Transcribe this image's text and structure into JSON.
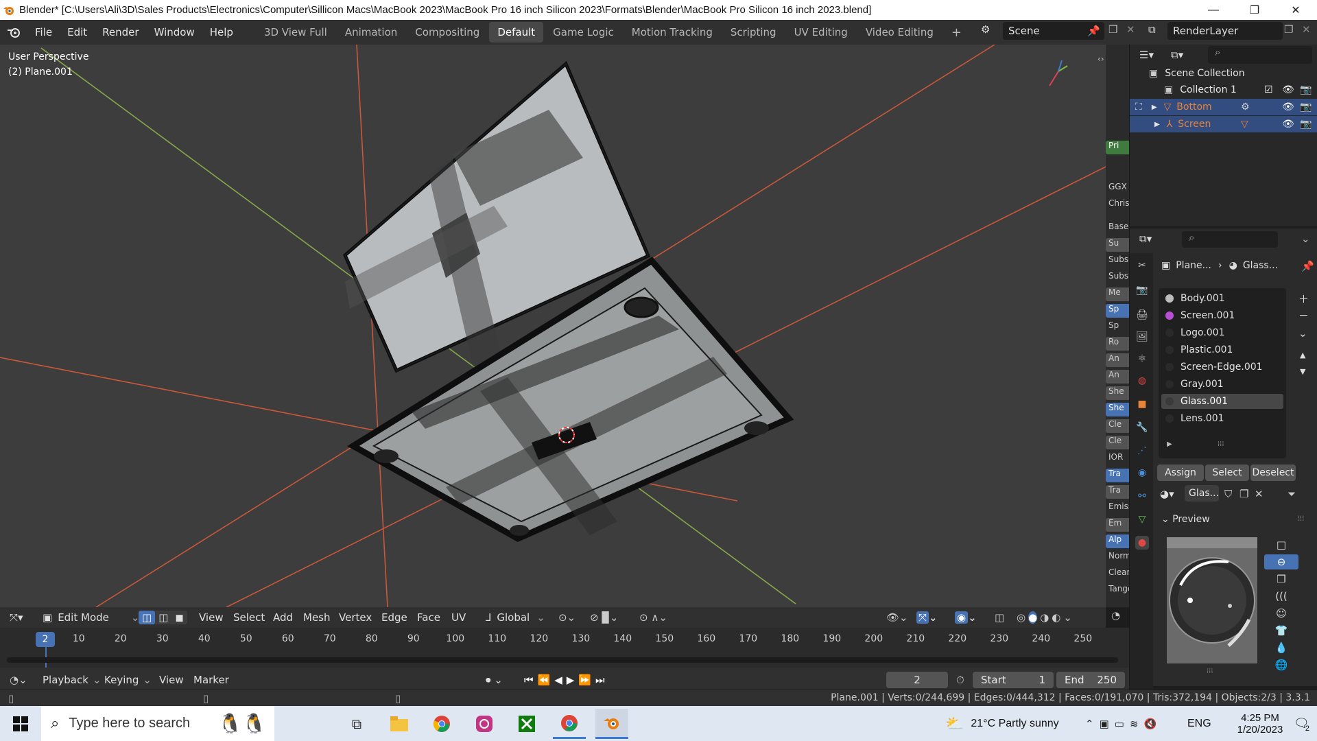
{
  "window": {
    "title": "Blender* [C:\\Users\\Ali\\3D\\Sales Products\\Electronics\\Computer\\Sillicon Macs\\MacBook 2023\\MacBook Pro 16 inch Silicon 2023\\Formats\\Blender\\MacBook Pro Silicon 16 inch 2023.blend]",
    "minimize": "—",
    "restore": "❐",
    "close": "✕"
  },
  "menu": [
    "File",
    "Edit",
    "Render",
    "Window",
    "Help"
  ],
  "workspaces": [
    {
      "label": "3D View Full",
      "active": false
    },
    {
      "label": "Animation",
      "active": false
    },
    {
      "label": "Compositing",
      "active": false
    },
    {
      "label": "Default",
      "active": true
    },
    {
      "label": "Game Logic",
      "active": false
    },
    {
      "label": "Motion Tracking",
      "active": false
    },
    {
      "label": "Scripting",
      "active": false
    },
    {
      "label": "UV Editing",
      "active": false
    },
    {
      "label": "Video Editing",
      "active": false
    }
  ],
  "workspace_add": "+",
  "scene": {
    "name": "Scene",
    "view_layer": "RenderLayer"
  },
  "viewport": {
    "perspective": "User Perspective",
    "object": "(2) Plane.001"
  },
  "outliner": {
    "root": "Scene Collection",
    "collection": "Collection 1",
    "objects": [
      {
        "name": "Bottom",
        "color": "#e8833a"
      },
      {
        "name": "Screen",
        "color": "#e8833a"
      }
    ]
  },
  "props_strip": [
    "Pri",
    "GGX",
    "Chris",
    "Base C",
    "Su",
    "Subs",
    "Subsu",
    "Me",
    "Sp",
    "Sp",
    "Ro",
    "An",
    "An",
    "She",
    "She",
    "Cle",
    "Cle",
    "IOR",
    "Tra",
    "Tra",
    "Emiss",
    "Em",
    "Alp",
    "Norm",
    "Clearc",
    "Tange"
  ],
  "properties": {
    "breadcrumb_object": "Plane...",
    "breadcrumb_material": "Glass...",
    "materials": [
      {
        "name": "Body.001",
        "color": "#bdbdbd",
        "selected": false
      },
      {
        "name": "Screen.001",
        "color": "#b84fd6",
        "selected": false
      },
      {
        "name": "Logo.001",
        "color": "#2a2a2a",
        "selected": false
      },
      {
        "name": "Plastic.001",
        "color": "#2a2a2a",
        "selected": false
      },
      {
        "name": "Screen-Edge.001",
        "color": "#2a2a2a",
        "selected": false
      },
      {
        "name": "Gray.001",
        "color": "#2a2a2a",
        "selected": false
      },
      {
        "name": "Glass.001",
        "color": "#3a3a3a",
        "selected": true
      },
      {
        "name": "Lens.001",
        "color": "#2a2a2a",
        "selected": false
      }
    ],
    "assign": "Assign",
    "select": "Select",
    "deselect": "Deselect",
    "material_field": "Glas...",
    "preview_label": "Preview"
  },
  "viewport_header": {
    "mode": "Edit Mode",
    "menus": [
      "View",
      "Select",
      "Add",
      "Mesh",
      "Vertex",
      "Edge",
      "Face",
      "UV"
    ],
    "orientation": "Global"
  },
  "timeline": {
    "current_frame_badge": "2",
    "ticks": [
      "10",
      "20",
      "30",
      "40",
      "50",
      "60",
      "70",
      "80",
      "90",
      "100",
      "110",
      "120",
      "130",
      "140",
      "150",
      "160",
      "170",
      "180",
      "190",
      "200",
      "210",
      "220",
      "230",
      "240",
      "250"
    ],
    "menus": [
      "Playback",
      "Keying",
      "View",
      "Marker"
    ],
    "frame": "2",
    "start_label": "Start",
    "start": "1",
    "end_label": "End",
    "end": "250"
  },
  "status": {
    "text": "Plane.001 | Verts:0/244,699 | Edges:0/444,312 | Faces:0/191,070 | Tris:372,194 | Objects:2/3 | 3.3.1"
  },
  "taskbar": {
    "search_placeholder": "Type here to search",
    "weather": "21°C  Partly sunny",
    "lang": "ENG",
    "time": "4:25 PM",
    "date": "1/20/2023",
    "notifications": "2"
  }
}
